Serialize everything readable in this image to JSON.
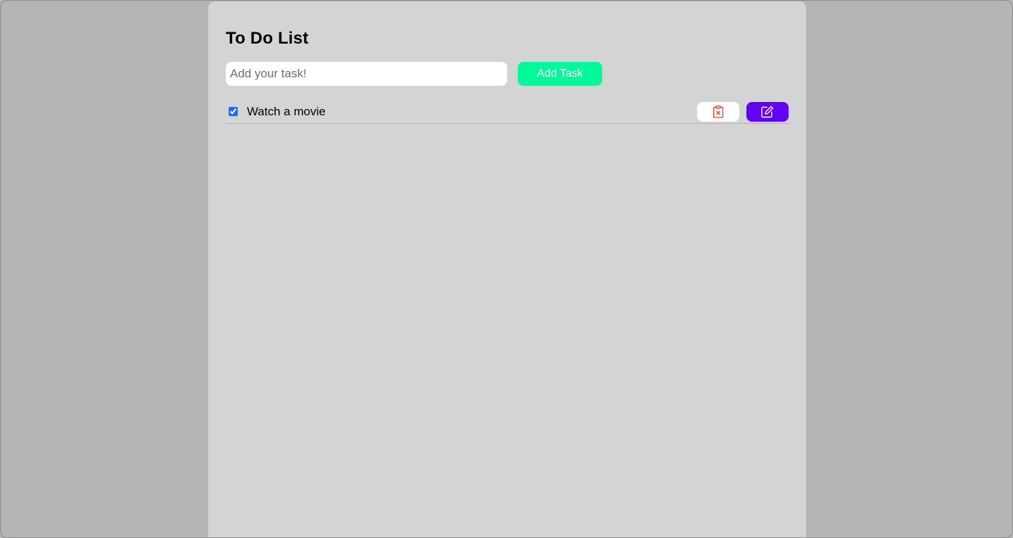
{
  "app": {
    "title": "To Do List"
  },
  "input": {
    "placeholder": "Add your task!",
    "value": ""
  },
  "add_button": {
    "label": "Add Task"
  },
  "tasks": [
    {
      "text": "Watch a movie",
      "checked": true,
      "delete_icon": "clipboard-x-icon",
      "edit_icon": "pencil-square-icon"
    }
  ],
  "colors": {
    "page_background": "#b5b5b5",
    "card_background": "#d4d4d4",
    "add_button": "#00fa9a",
    "delete_icon": "#e53935",
    "edit_button": "#6200ff",
    "checkbox": "#1a6ef5"
  }
}
